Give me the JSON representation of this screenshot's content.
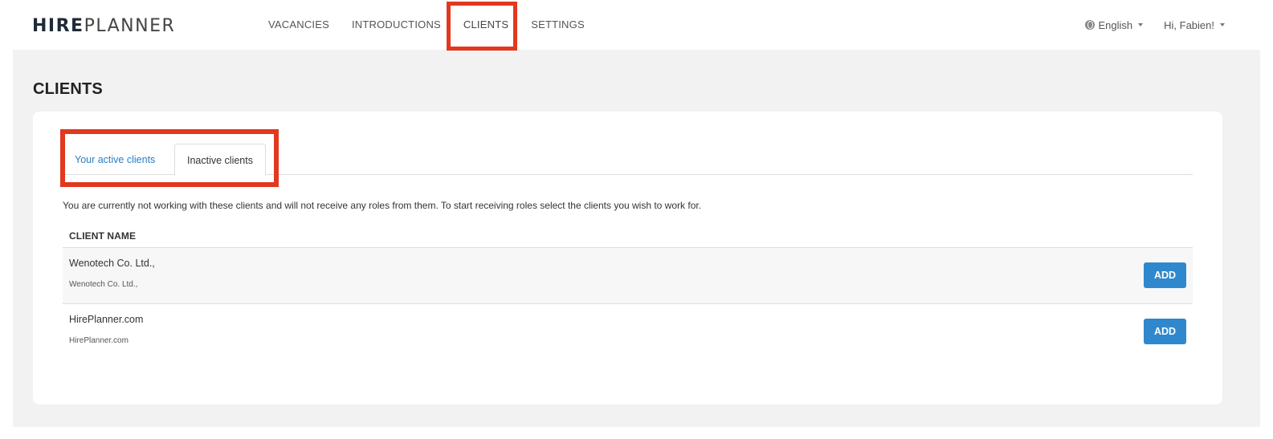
{
  "brand": {
    "hire": "HIRE",
    "planner": "PLANNER"
  },
  "nav": {
    "items": [
      {
        "label": "VACANCIES"
      },
      {
        "label": "INTRODUCTIONS"
      },
      {
        "label": "CLIENTS"
      },
      {
        "label": "SETTINGS"
      }
    ],
    "active": "CLIENTS",
    "language": "English",
    "user_greeting": "Hi, Fabien!"
  },
  "page": {
    "title": "CLIENTS"
  },
  "tabs": [
    {
      "label": "Your active clients"
    },
    {
      "label": "Inactive clients"
    }
  ],
  "selected_tab": "Inactive clients",
  "notice": "You are currently not working with these clients and will not receive any roles from them. To start receiving roles select the clients you wish to work for.",
  "table": {
    "header": "CLIENT NAME",
    "rows": [
      {
        "name": "Wenotech Co. Ltd.,",
        "sub": "Wenotech Co. Ltd.,",
        "action": "ADD"
      },
      {
        "name": "HirePlanner.com",
        "sub": "HirePlanner.com",
        "action": "ADD"
      }
    ]
  },
  "colors": {
    "accent": "#2f88cd",
    "highlight": "#e1381f",
    "link": "#2a7fc4"
  }
}
